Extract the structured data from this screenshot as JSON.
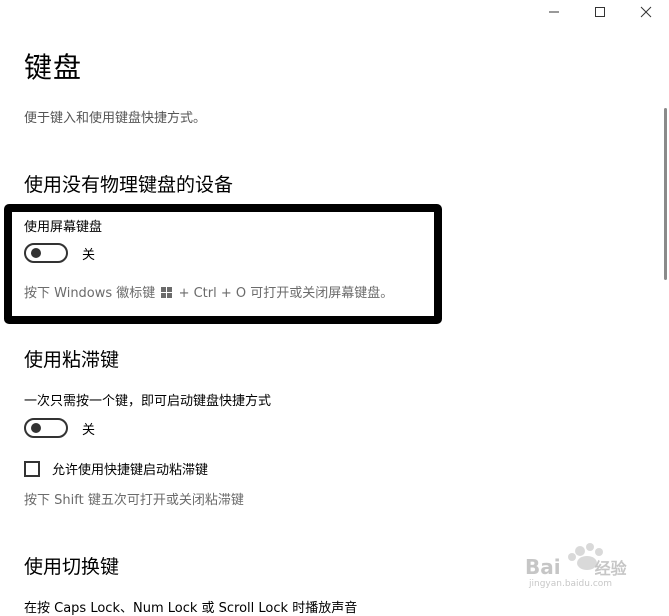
{
  "window": {
    "controls": [
      "minimize-icon",
      "maximize-icon",
      "close-icon"
    ]
  },
  "page": {
    "title": "键盘",
    "description": "便于键入和使用键盘快捷方式。"
  },
  "section_onscreen": {
    "heading": "使用没有物理键盘的设备",
    "toggle_label": "使用屏幕键盘",
    "toggle_state": "关",
    "toggle_on": false,
    "hint_before": "按下 Windows 徽标键",
    "hint_after": "+ Ctrl + O 可打开或关闭屏幕键盘。"
  },
  "section_sticky": {
    "heading": "使用粘滞键",
    "toggle_label": "一次只需按一个键，即可启动键盘快捷方式",
    "toggle_state": "关",
    "toggle_on": false,
    "checkbox_label": "允许使用快捷键启动粘滞键",
    "checkbox_checked": false,
    "hint": "按下 Shift 键五次可打开或关闭粘滞键"
  },
  "section_toggle_keys": {
    "heading": "使用切换键",
    "partial_text": "在按 Caps Lock、Num Lock 或 Scroll Lock 时播放声音"
  },
  "watermark": {
    "brand": "Bai",
    "brand_suffix": "经验",
    "url": "jingyan.baidu.com"
  },
  "colors": {
    "highlight_border": "#000000",
    "hint_text": "#6b6b6b"
  }
}
